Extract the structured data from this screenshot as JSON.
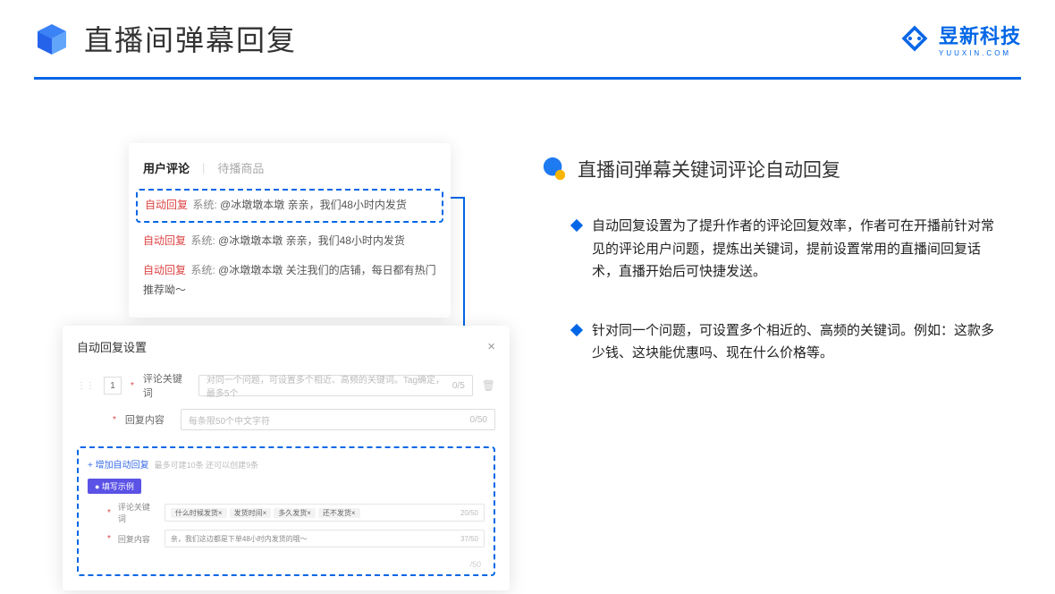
{
  "header": {
    "title": "直播间弹幕回复",
    "brand": "昱新科技",
    "brand_sub": "YUUXIN.COM"
  },
  "right": {
    "section_title": "直播间弹幕关键词评论自动回复",
    "bullets": [
      "自动回复设置为了提升作者的评论回复效率，作者可在开播前针对常见的评论用户问题，提炼出关键词，提前设置常用的直播间回复话术，直播开始后可快捷发送。",
      "针对同一个问题，可设置多个相近的、高频的关键词。例如：这款多少钱、这块能优惠吗、现在什么价格等。"
    ]
  },
  "comments": {
    "tab_active": "用户评论",
    "tab_inactive": "待播商品",
    "badge": "自动回复",
    "sys": "系统:",
    "row1": "@冰墩墩本墩 亲亲，我们48小时内发货",
    "row2": "@冰墩墩本墩 亲亲，我们48小时内发货",
    "row3": "@冰墩墩本墩 关注我们的店铺，每日都有热门推荐呦～"
  },
  "settings": {
    "title": "自动回复设置",
    "order": "1",
    "label_keyword": "评论关键词",
    "placeholder_keyword": "对同一个问题，可设置多个相近、高频的关键词。Tag确定，最多5个",
    "counter_keyword": "0/5",
    "label_content": "回复内容",
    "placeholder_content": "每条限50个中文字符",
    "counter_content": "0/50",
    "add_text": "+ 增加自动回复",
    "add_hint": "最多可建10条 还可以创建9条",
    "example_badge": "● 填写示例",
    "ex_label_keyword": "评论关键词",
    "ex_tags": [
      "什么时候发货×",
      "发货时间×",
      "多久发货×",
      "还不发货×"
    ],
    "ex_counter_keyword": "20/50",
    "ex_label_content": "回复内容",
    "ex_content": "亲，我们这边都是下单48小时内发货的哦～",
    "ex_counter_content": "37/50",
    "ghost_counter": "/50"
  }
}
